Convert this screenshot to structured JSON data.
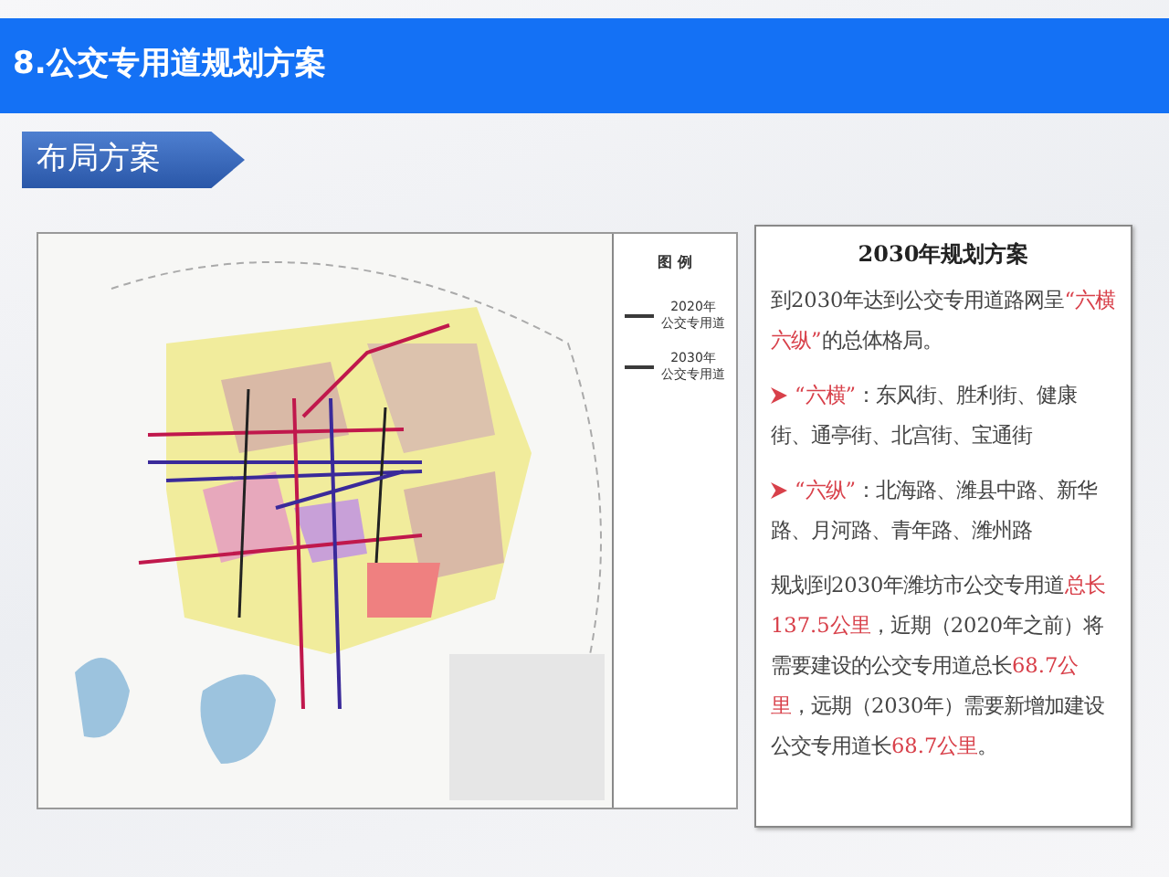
{
  "header": {
    "title": "8.公交专用道规划方案"
  },
  "section_tag": {
    "label": "布局方案"
  },
  "map": {
    "legend": {
      "title": "图  例",
      "items": [
        {
          "year": "2020年",
          "label": "公交专用道",
          "color": "#3a3a3a"
        },
        {
          "year": "2030年",
          "label": "公交专用道",
          "color": "#3a3a3a"
        }
      ]
    }
  },
  "plan": {
    "title": "2030年规划方案",
    "paragraphs": [
      {
        "kind": "text",
        "segments": [
          {
            "text": "到2030年达到公交专用道路网呈",
            "highlight": false
          },
          {
            "text": "“六横六纵”",
            "highlight": true
          },
          {
            "text": "的总体格局。",
            "highlight": false
          }
        ]
      },
      {
        "kind": "bullet",
        "segments": [
          {
            "text": "“六横”",
            "highlight": true
          },
          {
            "text": "：东风街、胜利街、健康街、通亭街、北宫街、宝通街",
            "highlight": false
          }
        ]
      },
      {
        "kind": "bullet",
        "segments": [
          {
            "text": "“六纵”",
            "highlight": true
          },
          {
            "text": "：北海路、潍县中路、新华路、月河路、青年路、潍州路",
            "highlight": false
          }
        ]
      },
      {
        "kind": "text",
        "segments": [
          {
            "text": "规划到2030年潍坊市公交专用道",
            "highlight": false
          },
          {
            "text": "总长137.5公里",
            "highlight": true
          },
          {
            "text": "，近期（2020年之前）将需要建设的公交专用道总长",
            "highlight": false
          },
          {
            "text": "68.7公里",
            "highlight": true
          },
          {
            "text": "，远期（2030年）需要新增加建设公交专用道长",
            "highlight": false
          },
          {
            "text": "68.7公里",
            "highlight": true
          },
          {
            "text": "。",
            "highlight": false
          }
        ]
      }
    ]
  }
}
